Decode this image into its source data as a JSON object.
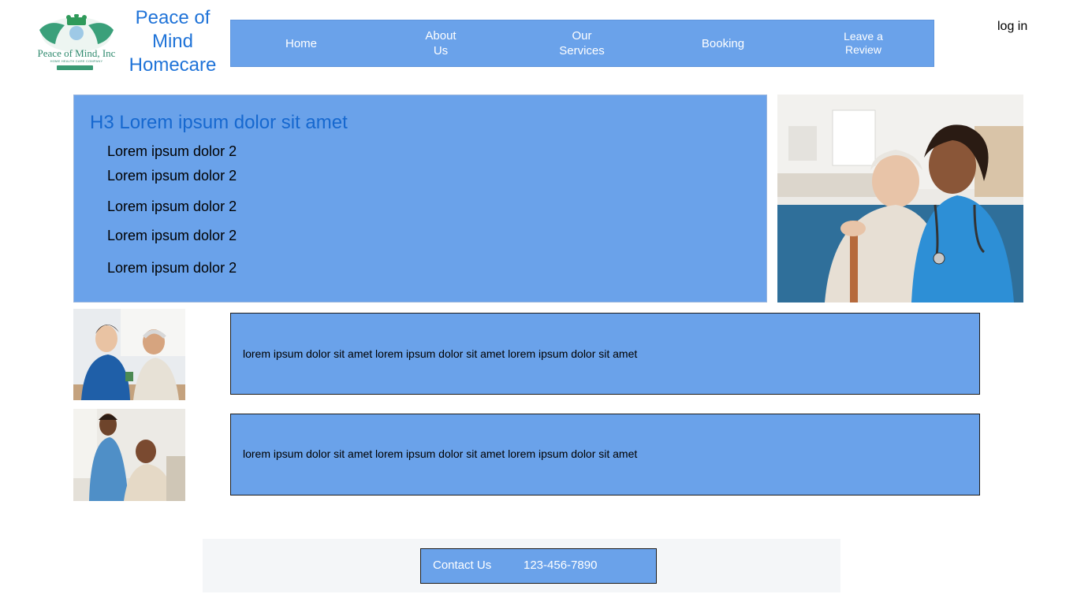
{
  "brand": {
    "logo_text": "Peace of Mind, Inc",
    "logo_subtext": "HOME HEALTH CARE COMPANY",
    "title_line1": "Peace of",
    "title_line2": "Mind",
    "title_line3": "Homecare"
  },
  "nav": {
    "items": [
      {
        "label": "Home"
      },
      {
        "label": "About\nUs"
      },
      {
        "label": "Our\nServices"
      },
      {
        "label": "Booking"
      },
      {
        "label": "Leave a\nReview"
      }
    ],
    "login": "log in"
  },
  "hero": {
    "title": "H3 Lorem ipsum dolor sit amet",
    "items": [
      "Lorem ipsum dolor 2",
      "Lorem ipsum dolor 2",
      "Lorem ipsum dolor 2",
      "Lorem ipsum dolor 2",
      "Lorem ipsum dolor 2"
    ]
  },
  "rows": [
    {
      "text": "lorem ipsum dolor sit amet lorem ipsum dolor sit amet lorem ipsum dolor sit amet"
    },
    {
      "text": "lorem ipsum dolor sit amet lorem ipsum dolor sit amet lorem ipsum dolor sit amet"
    }
  ],
  "footer": {
    "contact_label": "Contact Us",
    "phone": "123-456-7890"
  },
  "colors": {
    "nav_bg": "#6aa2ea",
    "brand_blue": "#1f73d8",
    "hero_title": "#1668cf"
  }
}
